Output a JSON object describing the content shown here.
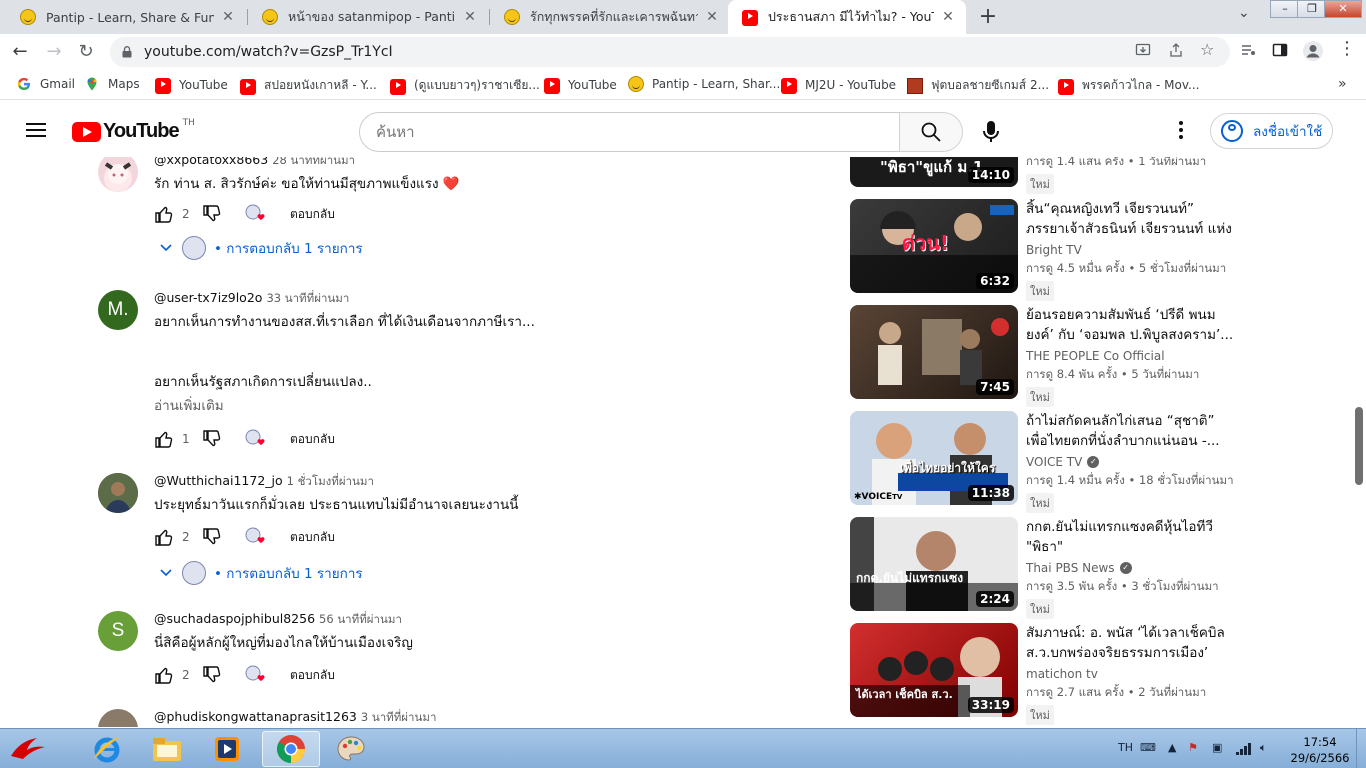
{
  "browser": {
    "tabs": [
      {
        "title": "Pantip - Learn, Share & Fun",
        "icon": "pantip-icon",
        "active": false
      },
      {
        "title": "หน้าของ satanmipop - Pantip",
        "icon": "pantip-icon",
        "active": false
      },
      {
        "title": "รักทุกพรรคที่รักและเคารพฉันทามติ",
        "icon": "pantip-icon",
        "active": false
      },
      {
        "title": "ประธานสภา มีไว้ทำไม? - YouTube",
        "icon": "youtube-icon",
        "active": true
      }
    ],
    "new_tab": "+",
    "url": "youtube.com/watch?v=GzsP_Tr1YcI",
    "bookmarks": [
      {
        "label": "Gmail",
        "icon": "google-icon"
      },
      {
        "label": "Maps",
        "icon": "maps-icon"
      },
      {
        "label": "YouTube",
        "icon": "youtube-icon"
      },
      {
        "label": "สปอยหนังเกาหลี - Y...",
        "icon": "youtube-icon"
      },
      {
        "label": "(ดูแบบยาวๆ)ราชาเซีย...",
        "icon": "youtube-icon"
      },
      {
        "label": "YouTube",
        "icon": "youtube-icon"
      },
      {
        "label": "Pantip - Learn, Shar...",
        "icon": "pantip-icon"
      },
      {
        "label": "MJ2U - YouTube",
        "icon": "youtube-icon"
      },
      {
        "label": "ฟุตบอลชายซีเกมส์ 2...",
        "icon": "news-icon"
      },
      {
        "label": "พรรคก้าวไกล - Mov...",
        "icon": "youtube-icon"
      }
    ],
    "bookmarks_more": "»"
  },
  "youtube": {
    "logo_text": "YouTube",
    "country_code": "TH",
    "search_placeholder": "ค้นหา",
    "sign_in": "ลงชื่อเข้าใช้"
  },
  "comments": [
    {
      "author": "@xxpotatoxx8663",
      "time": "28 นาทีที่ผ่านมา",
      "text": "รัก ท่าน ส. สิวรักษ์ค่ะ  ขอให้ท่านมีสุขภาพแข็งแรง ❤️",
      "likes": "2",
      "reply_label": "ตอบกลับ",
      "replies": "การตอบกลับ 1 รายการ",
      "read_more": "",
      "avatar_letter": "",
      "avatar_color": "#f3d6dc"
    },
    {
      "author": "@user-tx7iz9lo2o",
      "time": "33 นาทีที่ผ่านมา",
      "text": "อยากเห็นการทำงานของสส.ที่เราเลือก ที่ได้เงินเดือนจากภาษีเรา...\n\n\nอยากเห็นรัฐสภาเกิดการเปลี่ยนแปลง..",
      "likes": "1",
      "reply_label": "ตอบกลับ",
      "replies": "",
      "read_more": "อ่านเพิ่มเติม",
      "avatar_letter": "M.",
      "avatar_color": "#33691e"
    },
    {
      "author": "@Wutthichai1172_jo",
      "time": "1 ชั่วโมงที่ผ่านมา",
      "text": "ประยุทธ์มาวันแรกก็มั่วเลย  ประธานแทบไม่มีอำนาจเลยนะงานนี้",
      "likes": "2",
      "reply_label": "ตอบกลับ",
      "replies": "การตอบกลับ 1 รายการ",
      "read_more": "",
      "avatar_letter": "",
      "avatar_color": "#3d4a2e"
    },
    {
      "author": "@suchadaspojphibul8256",
      "time": "56 นาทีที่ผ่านมา",
      "text": "นี่สิคือผู้หลักผู้ใหญ่ที่มองไกลให้บ้านเมืองเจริญ",
      "likes": "2",
      "reply_label": "ตอบกลับ",
      "replies": "",
      "read_more": "",
      "avatar_letter": "S",
      "avatar_color": "#689f38"
    },
    {
      "author": "@phudiskongwattanaprasit1263",
      "time": "3 นาทีที่ผ่านมา",
      "text": "",
      "likes": "",
      "reply_label": "",
      "replies": "",
      "read_more": "",
      "avatar_letter": "",
      "avatar_color": "#8a7a6a"
    }
  ],
  "videos": [
    {
      "title": "",
      "channel": "",
      "verified": false,
      "stats": "การดู 1.4 แสน ครั้ง • 1 วันที่ผ่านมา",
      "badge": "ใหม่",
      "duration": "14:10",
      "thumb_text": "\"พิธา\"ขูแก้ ม.1",
      "thumb_bg": "#1a1a1a"
    },
    {
      "title": "สิ้น“คุณหญิงเทวี เจียรวนนท์” ภรรยาเจ้าสัวธนินท์ เจียรวนนท์ แห่งเครือ...",
      "channel": "Bright TV",
      "verified": false,
      "stats": "การดู 4.5 หมื่น ครั้ง • 5 ชั่วโมงที่ผ่านมา",
      "badge": "ใหม่",
      "duration": "6:32",
      "thumb_text": "ด่วน!",
      "thumb_bg": "#2b2b2b"
    },
    {
      "title": "ย้อนรอยความสัมพันธ์ ‘ปรีดี พนมยงค์’ กับ ‘จอมพล ป.พิบูลสงคราม’...",
      "channel": "THE PEOPLE Co Official",
      "verified": false,
      "stats": "การดู 8.4 พัน ครั้ง • 5 วันที่ผ่านมา",
      "badge": "ใหม่",
      "duration": "7:45",
      "thumb_text": "",
      "thumb_bg": "#3a2a22"
    },
    {
      "title": "ถ้าไม่สกัดคนลักไก่เสนอ “สุชาติ” เพื่อไทยตกที่นั่งลำบากแน่นอน -...",
      "channel": "VOICE TV",
      "verified": true,
      "stats": "การดู 1.4 หมื่น ครั้ง • 18 ชั่วโมงที่ผ่านมา",
      "badge": "ใหม่",
      "duration": "11:38",
      "thumb_text": "เพื่อไทยอย่าให้ใคร",
      "thumb_bg": "#c9d6e6"
    },
    {
      "title": "กกต.ยันไม่แทรกแซงคดีหุ้นไอทีวี \"พิธา\"",
      "channel": "Thai PBS News",
      "verified": true,
      "stats": "การดู 3.5 พัน ครั้ง • 3 ชั่วโมงที่ผ่านมา",
      "badge": "ใหม่",
      "duration": "2:24",
      "thumb_text": "กกต.ยันไม่แทรกแซง",
      "thumb_bg": "#4a4a4a"
    },
    {
      "title": "สัมภาษณ์: อ. พนัส ‘ได้เวลาเช็คบิล ส.ว.บกพร่องจริยธรรมการเมือง’ ไม่...",
      "channel": "matichon tv",
      "verified": false,
      "stats": "การดู 2.7 แสน ครั้ง • 2 วันที่ผ่านมา",
      "badge": "ใหม่",
      "duration": "33:19",
      "thumb_text": "ได้เวลา เช็คบิล ส.ว.",
      "thumb_bg": "#b71c1c"
    }
  ],
  "taskbar": {
    "lang": "TH",
    "time": "17:54",
    "date": "29/6/2566"
  }
}
